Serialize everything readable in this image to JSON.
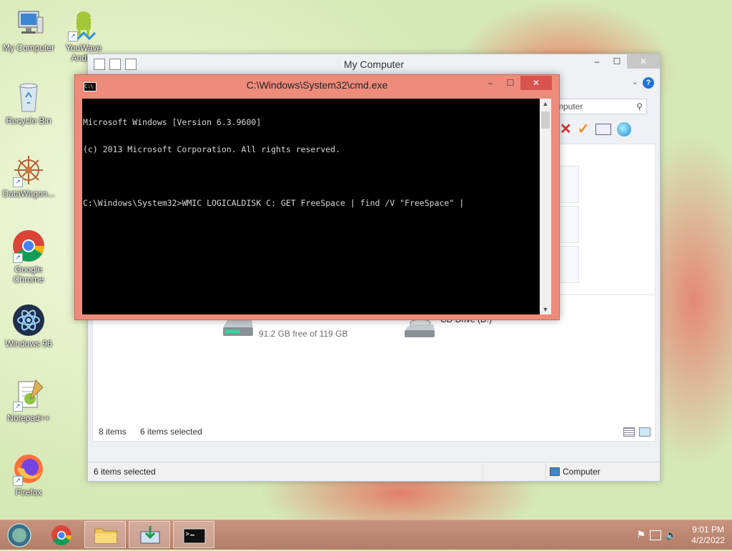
{
  "desktop": {
    "icons": [
      {
        "label": "My Computer",
        "icon": "computer-icon"
      },
      {
        "label": "YouWave Andr...",
        "icon": "android-icon"
      },
      {
        "label": "Recycle Bin",
        "icon": "recycle-bin-icon"
      },
      {
        "label": "DataWagon...",
        "icon": "datawagon-icon"
      },
      {
        "label": "Google Chrome",
        "icon": "chrome-icon"
      },
      {
        "label": "Windows 96",
        "icon": "windows96-icon"
      },
      {
        "label": "Notepad++",
        "icon": "notepad-plus-plus-icon"
      },
      {
        "label": "Firefox",
        "icon": "firefox-icon"
      }
    ]
  },
  "explorer": {
    "title": "My Computer",
    "search_placeholder": "mputer",
    "drive_c_free": "91.2 GB free of 119 GB",
    "drive_c_used_fraction": 0.23,
    "drive_d_label": "CD Drive (D:)",
    "item_count": "8 items",
    "selected_count": "6 items selected",
    "status_selected": "6 items selected",
    "status_location": "Computer"
  },
  "cmd": {
    "title": "C:\\Windows\\System32\\cmd.exe",
    "icon_text": "C:\\",
    "lines": [
      "Microsoft Windows [Version 6.3.9600]",
      "(c) 2013 Microsoft Corporation. All rights reserved.",
      "",
      "C:\\Windows\\System32>WMIC LOGICALDISK C: GET FreeSpace | find /V \"FreeSpace\" |"
    ]
  },
  "taskbar": {
    "time": "9:01 PM",
    "date": "4/2/2022",
    "buttons": [
      {
        "name": "start-button",
        "icon": "start-orb-icon"
      },
      {
        "name": "taskbar-chrome",
        "icon": "chrome-icon"
      },
      {
        "name": "taskbar-explorer",
        "icon": "folder-icon"
      },
      {
        "name": "taskbar-app",
        "icon": "download-icon"
      },
      {
        "name": "taskbar-cmd",
        "icon": "cmd-icon"
      }
    ]
  }
}
